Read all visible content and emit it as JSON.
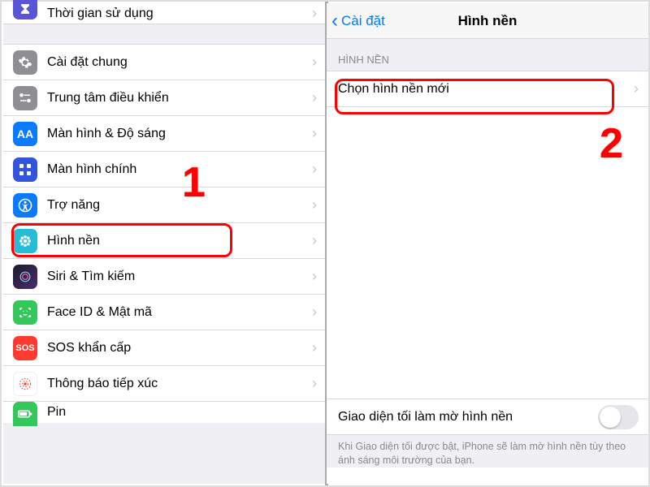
{
  "left": {
    "row_partial_top": "Thời gian sử dụng",
    "items": [
      "Cài đặt chung",
      "Trung tâm điều khiển",
      "Màn hình & Độ sáng",
      "Màn hình chính",
      "Trợ năng",
      "Hình nền",
      "Siri & Tìm kiếm",
      "Face ID & Mật mã",
      "SOS khẩn cấp",
      "Thông báo tiếp xúc",
      "Pin"
    ]
  },
  "right": {
    "back": "Cài đặt",
    "title": "Hình nền",
    "section": "HÌNH NỀN",
    "choose": "Chọn hình nền mới",
    "dark_label": "Giao diện tối làm mờ hình nền",
    "footer": "Khi Giao diện tối được bật, iPhone sẽ làm mờ hình nền tùy theo ánh sáng môi trường của bạn."
  },
  "digits": {
    "one": "1",
    "two": "2"
  }
}
